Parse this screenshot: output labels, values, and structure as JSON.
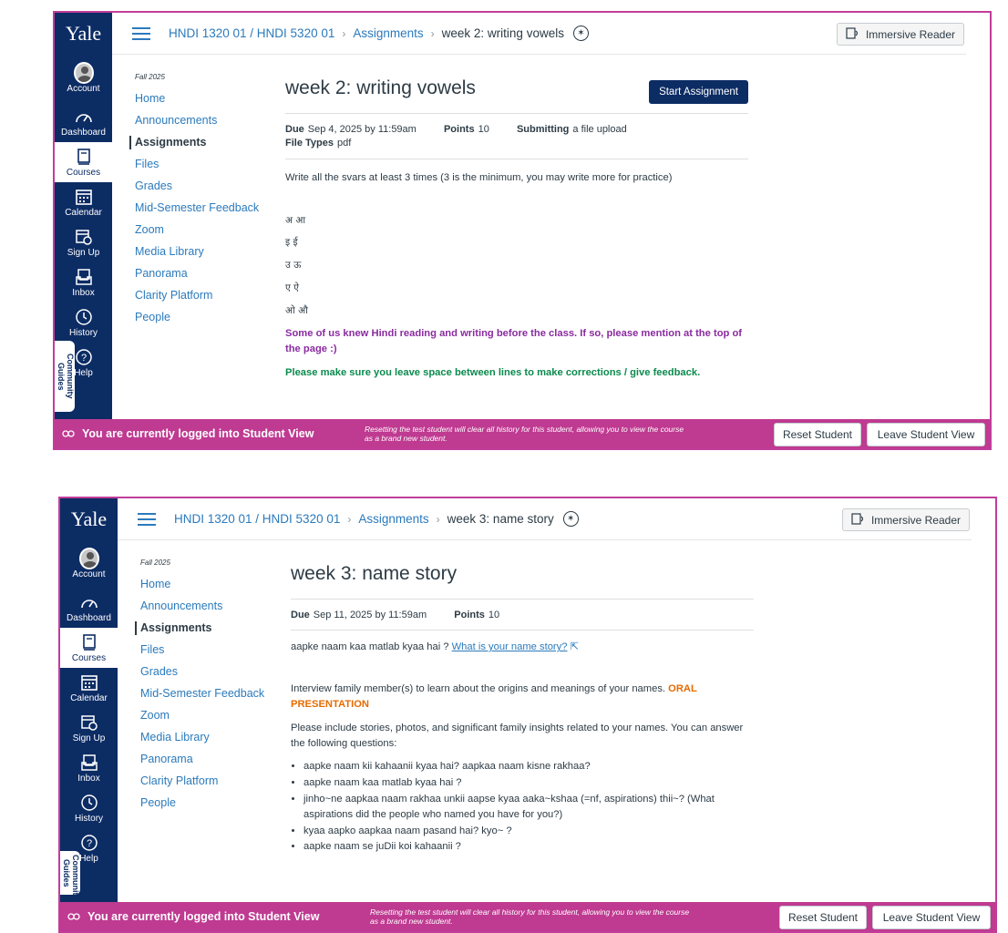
{
  "colors": {
    "nav_bg": "#0c2c64",
    "brand_pink": "#bf3a91",
    "link_blue": "#2b7abc",
    "purple_text": "#8a2ba0",
    "green_text": "#0b8a4d",
    "orange_text": "#e66b00"
  },
  "global_nav": {
    "logo": "Yale",
    "account": "Account",
    "dashboard": "Dashboard",
    "courses": "Courses",
    "calendar": "Calendar",
    "signup": "Sign Up",
    "inbox": "Inbox",
    "history": "History",
    "help": "Help",
    "community": "Community Guides"
  },
  "course_nav": {
    "term": "Fall 2025",
    "items": [
      "Home",
      "Announcements",
      "Assignments",
      "Files",
      "Grades",
      "Mid-Semester Feedback",
      "Zoom",
      "Media Library",
      "Panorama",
      "Clarity Platform",
      "People"
    ]
  },
  "breadcrumb": {
    "course": "HNDI 1320 01 / HNDI 5320 01",
    "section": "Assignments"
  },
  "immersive_reader": "Immersive Reader",
  "student_view": {
    "label": "You are currently logged into Student View",
    "note": "Resetting the test student will clear all history for this student, allowing you to view the course as a brand new student.",
    "reset": "Reset Student",
    "leave": "Leave Student View"
  },
  "labels": {
    "due": "Due",
    "points": "Points",
    "submitting": "Submitting",
    "file_types": "File Types"
  },
  "assignment1": {
    "title": "week 2: writing vowels",
    "start_button": "Start Assignment",
    "due": "Sep 4, 2025 by 11:59am",
    "points": "10",
    "submitting": "a file upload",
    "file_types": "pdf",
    "instruction": "Write all the svars at least 3 times (3 is the minimum, you may write more for practice)",
    "vowels": [
      "अ आ",
      "इ ई",
      "उ ऊ",
      "ए ऐ",
      "ओ औ"
    ],
    "purple_note": "Some of us knew Hindi reading and writing before the class. If so, please mention at the top of the page :)",
    "green_note": "Please make sure you leave space between lines to make corrections / give feedback."
  },
  "assignment2": {
    "title": "week 3: name story",
    "due": "Sep 11, 2025 by 11:59am",
    "points": "10",
    "intro": "aapke naam kaa matlab kyaa hai ?",
    "link": "What is your name story?",
    "interview": "Interview family member(s) to learn about the origins and meanings of your names.",
    "oral": "ORAL PRESENTATION",
    "please": "Please include stories, photos, and significant family insights related to your names. You can answer the following questions:",
    "questions": [
      "aapke naam kii kahaanii kyaa hai? aapkaa naam kisne rakhaa?",
      "aapke naam kaa matlab kyaa hai ?",
      "jinho~ne aapkaa naam rakhaa unkii aapse kyaa aaka~kshaa (=nf, aspirations) thii~? (What aspirations did the people who named you have for you?)",
      "kyaa aapko aapkaa naam pasand hai? kyo~ ?",
      "aapke naam se juDii koi kahaanii ?"
    ]
  }
}
